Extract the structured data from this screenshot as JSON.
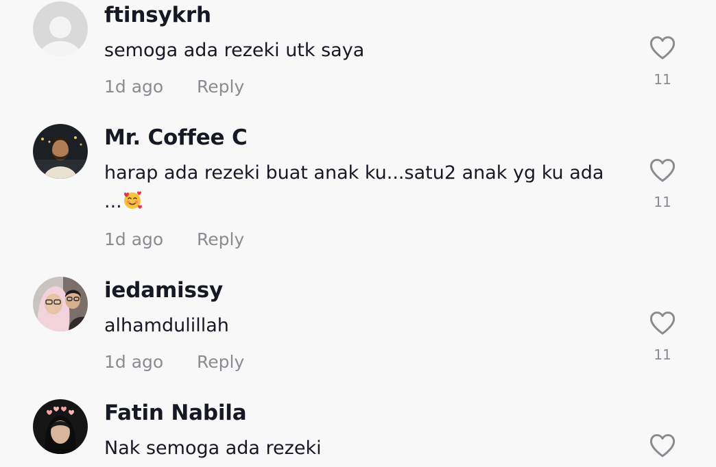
{
  "comments": [
    {
      "username": "ftinsykrh",
      "text": "semoga ada rezeki utk saya",
      "time": "1d ago",
      "reply": "Reply",
      "likes": "11",
      "avatar": "default-avatar-icon"
    },
    {
      "username": "Mr. Coffee C",
      "text_line1": "harap ada rezeki buat anak ku...satu2 anak yg ku ada",
      "text_line2": "...",
      "emoji": "smiling-face-with-hearts-emoji",
      "time": "1d ago",
      "reply": "Reply",
      "likes": "11",
      "avatar": "bearded-man-night-photo"
    },
    {
      "username": "iedamissy",
      "text": "alhamdulillah",
      "time": "1d ago",
      "reply": "Reply",
      "likes": "11",
      "avatar": "couple-selfie-photo"
    },
    {
      "username": "Fatin Nabila",
      "text": "Nak semoga ada rezeki",
      "avatar": "girl-with-heart-crown-photo"
    }
  ],
  "colors": {
    "background": "#f8f8f8",
    "primary_text": "#161823",
    "secondary_text": "#8a8b91"
  }
}
